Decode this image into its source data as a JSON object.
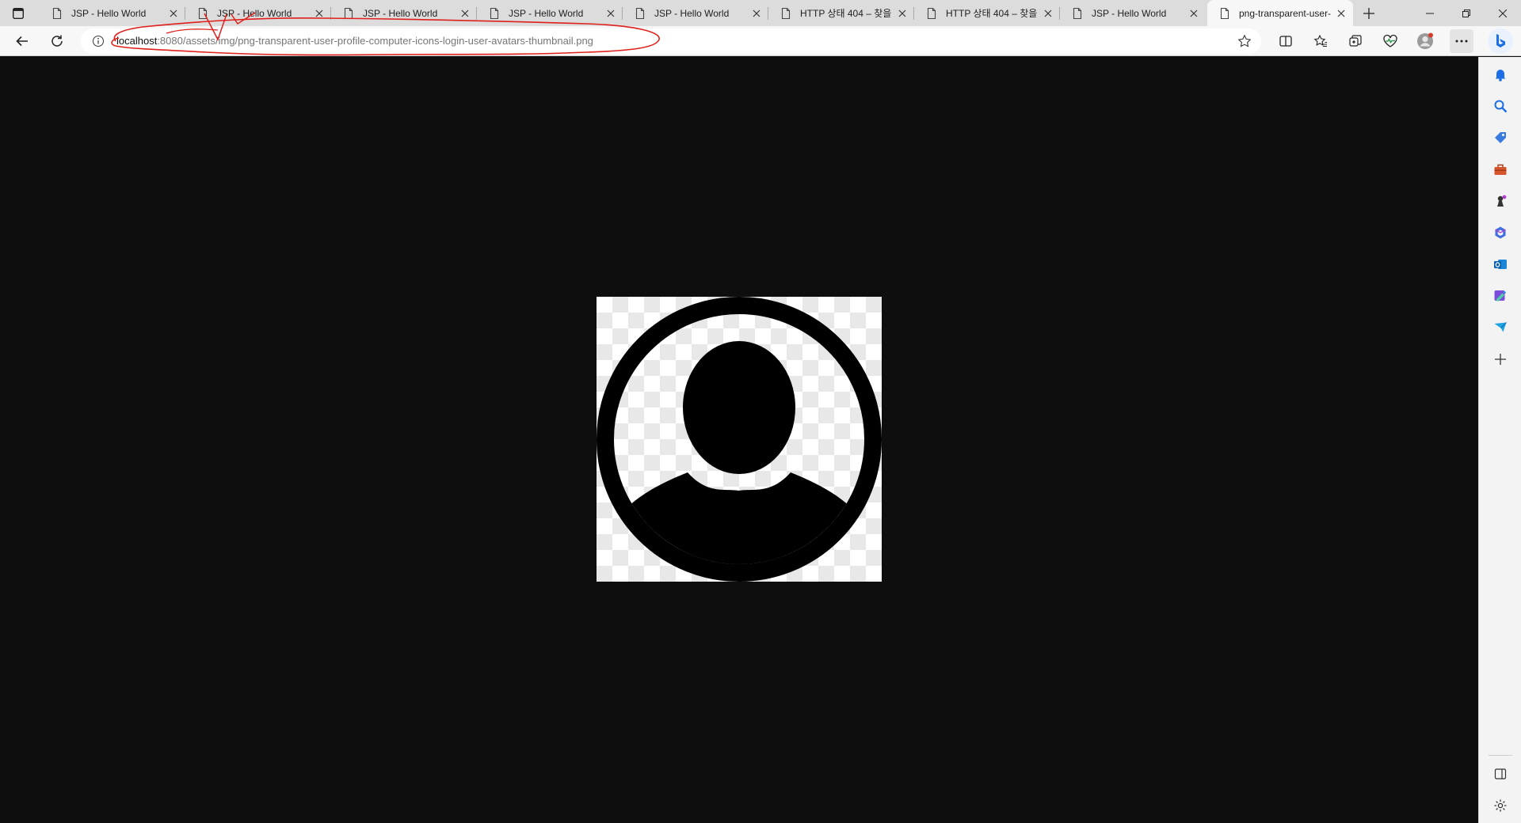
{
  "tabs": [
    {
      "title": "JSP - Hello World",
      "active": false
    },
    {
      "title": "JSP - Hello World",
      "active": false
    },
    {
      "title": "JSP - Hello World",
      "active": false
    },
    {
      "title": "JSP - Hello World",
      "active": false
    },
    {
      "title": "JSP - Hello World",
      "active": false
    },
    {
      "title": "HTTP 상태 404 – 찾을",
      "active": false
    },
    {
      "title": "HTTP 상태 404 – 찾을",
      "active": false
    },
    {
      "title": "JSP - Hello World",
      "active": false
    },
    {
      "title": "png-transparent-user-",
      "active": true
    }
  ],
  "address_bar": {
    "host": "localhost",
    "rest": ":8080/assets/img/png-transparent-user-profile-computer-icons-login-user-avatars-thumbnail.png"
  },
  "viewer": {
    "image_subject": "user-avatar-icon",
    "background": "transparency-checkerboard"
  },
  "annotation_color": "#e0201b",
  "icons": {
    "tab_actions": "tab-actions-icon",
    "tab_favicon": "page-icon",
    "tab_close": "close-icon",
    "new_tab": "plus-icon",
    "minimize": "minimize-icon",
    "restore": "restore-icon",
    "window_close": "close-icon",
    "back": "back-arrow-icon",
    "refresh": "refresh-icon",
    "site_info": "info-icon",
    "favorite": "star-icon",
    "split_screen": "split-screen-icon",
    "favorites": "favorites-icon",
    "collections": "collections-icon",
    "browser_essentials": "heart-pulse-icon",
    "profile": "profile-icon",
    "more": "ellipsis-icon",
    "copilot": "bing-icon"
  },
  "sidebar_icons": [
    "bell-icon",
    "search-icon",
    "shopping-tag-icon",
    "toolbox-icon",
    "games-icon",
    "microsoft365-icon",
    "outlook-icon",
    "designer-icon",
    "drop-icon",
    "add-icon"
  ],
  "sidebar_bottom_icons": [
    "hide-sidebar-icon",
    "settings-icon"
  ]
}
